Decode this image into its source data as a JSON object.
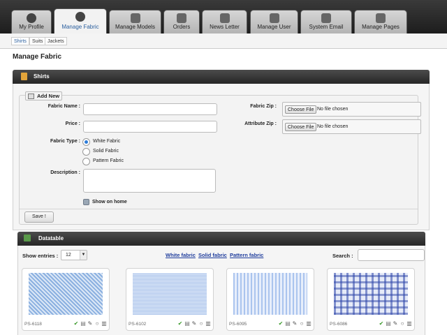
{
  "nav": {
    "tabs": [
      {
        "label": "My Profile",
        "icon": "user-icon"
      },
      {
        "label": "Manage Fabric",
        "icon": "user-icon"
      },
      {
        "label": "Manage Models",
        "icon": "puzzle-icon"
      },
      {
        "label": "Orders",
        "icon": "list-icon"
      },
      {
        "label": "News Letter",
        "icon": "newsletter-icon"
      },
      {
        "label": "Manage User",
        "icon": "user-card-icon"
      },
      {
        "label": "System Email",
        "icon": "email-icon"
      },
      {
        "label": "Manage Pages",
        "icon": "pages-icon"
      }
    ],
    "active": "Manage Fabric"
  },
  "subnav": {
    "items": [
      "Shirts",
      "Suits",
      "Jackets"
    ],
    "active": "Shirts"
  },
  "page": {
    "title": "Manage Fabric"
  },
  "shirts_section": {
    "title": "Shirts"
  },
  "form": {
    "legend": "Add New",
    "fabric_name_label": "Fabric Name :",
    "price_label": "Price :",
    "fabric_type_label": "Fabric Type :",
    "fabric_types": [
      "White Fabric",
      "Solid Fabric",
      "Pattern Fabric"
    ],
    "selected_fabric_type": "White Fabric",
    "description_label": "Description :",
    "show_on_home_label": "Show on home",
    "fabric_zip_label": "Fabric Zip :",
    "attribute_zip_label": "Attribute Zip :",
    "choose_file_label": "Choose File",
    "no_file_text": "No file chosen",
    "save_label": "Save !"
  },
  "datatable": {
    "title": "Datatable",
    "show_entries_label": "Show entries :",
    "entries_value": "12",
    "filter_links": [
      "White fabric",
      "Solid fabric",
      "Pattern fabric"
    ],
    "search_label": "Search :",
    "items": [
      {
        "code": "PS-6118",
        "pattern": "herringbone"
      },
      {
        "code": "PS-6102",
        "pattern": "fine-grid"
      },
      {
        "code": "PS-6095",
        "pattern": "pinstripe"
      },
      {
        "code": "PS-6086",
        "pattern": "check"
      }
    ]
  },
  "colors": {
    "accent": "#2a5f9e",
    "link": "#1e3c9c",
    "header_bar": "#333333"
  }
}
